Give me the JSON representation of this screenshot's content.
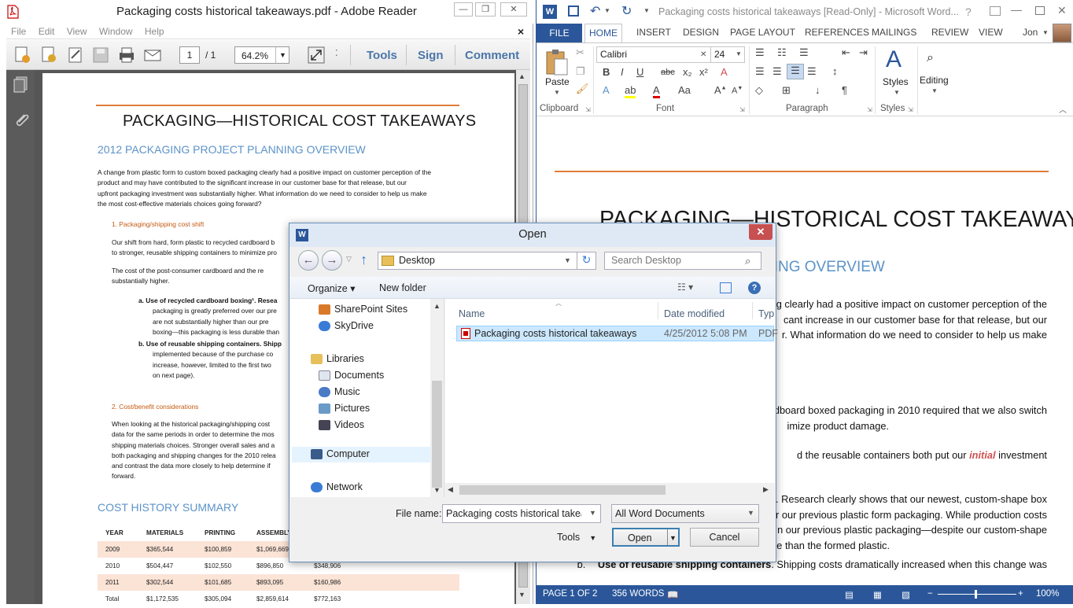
{
  "reader": {
    "title": "Packaging costs historical takeaways.pdf - Adobe Reader",
    "menu": [
      "File",
      "Edit",
      "View",
      "Window",
      "Help"
    ],
    "close_x": "×",
    "page_current": "1",
    "page_total": "/ 1",
    "zoom": "64.2%",
    "tools_label": "Tools",
    "sign_label": "Sign",
    "comment_label": "Comment",
    "doc": {
      "title": "PACKAGING—HISTORICAL COST TAKEAWAYS",
      "section1": "2012 PACKAGING PROJECT PLANNING OVERVIEW",
      "intro_lines": [
        "A change from plastic form to custom boxed packaging clearly had a positive impact on customer perception of the",
        "product and may have contributed to the significant increase in our customer base for that release, but our",
        "upfront packaging investment was substantially higher. What information do we need to consider to help us make",
        "the most cost-effective materials choices going forward?"
      ],
      "item1": "1.    Packaging/shipping cost shift",
      "item1_lines": [
        "Our shift from hard, form plastic to recycled cardboard b",
        "to stronger, reusable shipping containers to minimize pro"
      ],
      "item1_b_lines": [
        "The cost of the post-consumer cardboard and the re",
        "substantially higher."
      ],
      "sub_a_lines": [
        "a.    Use of recycled cardboard boxing¹. Resea",
        "packaging is greatly preferred over our pre",
        "are not substantially higher than our pre",
        "boxing—this packaging is less durable than"
      ],
      "sub_b_lines": [
        "b.    Use of reusable shipping containers. Shipp",
        "implemented because of the purchase co",
        "increase, however, limited to the first two",
        "on next page)."
      ],
      "item2": "2.    Cost/benefit considerations",
      "item2_lines": [
        "When looking at the historical packaging/shipping cost",
        "data for the same periods in order to determine the mos",
        "shipping materials choices. Stronger overall sales and a",
        "both packaging and shipping changes for the 2010 relea",
        "and contrast the data more closely to help determine if",
        "forward."
      ],
      "section2": "COST HISTORY SUMMARY",
      "table_headers": [
        "YEAR",
        "MATERIALS",
        "PRINTING",
        "ASSEMBLY",
        ""
      ],
      "table_rows": [
        [
          "2009",
          "$365,544",
          "$100,859",
          "$1,069,669",
          ""
        ],
        [
          "2010",
          "$504,447",
          "$102,550",
          "$896,850",
          "$348,906"
        ],
        [
          "2011",
          "$302,544",
          "$101,685",
          "$893,095",
          "$160,986"
        ],
        [
          "Total",
          "$1,172,535",
          "$305,094",
          "$2,859,614",
          "$772,163"
        ]
      ]
    }
  },
  "word": {
    "title": "Packaging costs historical takeaways [Read-Only] - Microsoft Word...",
    "help": "?",
    "user": "Jon",
    "tabs": [
      "FILE",
      "HOME",
      "INSERT",
      "DESIGN",
      "PAGE LAYOUT",
      "REFERENCES",
      "MAILINGS",
      "REVIEW",
      "VIEW"
    ],
    "font_name": "Calibri",
    "font_size": "24",
    "paste_label": "Paste",
    "styles_label": "Styles",
    "editing_label": "Editing",
    "groups": [
      "Clipboard",
      "Font",
      "Paragraph",
      "Styles"
    ],
    "doc": {
      "title": "PACKAGING—HISTORICAL COST TAKEAWAYS",
      "section1_tail": "NING OVERVIEW",
      "lines1": [
        "ng clearly had a positive impact on customer perception of the",
        "cant increase in our customer base for that release, but our",
        "r. What information do we need to consider to help us make",
        "ard?"
      ],
      "lines2": [
        "rdboard boxed packaging in 2010 required that we also switch",
        "imize product damage."
      ],
      "line3_pre": "d the reusable containers both put our",
      "line3_em": "initial",
      "line3_post": "investment",
      "lines4": [
        "g¹. Research clearly shows that our newest, custom-shape box",
        "r our previous plastic form packaging. While production costs",
        "n our previous plastic packaging—despite our custom-shape",
        "ble than the formed plastic."
      ],
      "line5_b": "b.",
      "line5_bold": "Use of reusable shipping containers",
      "line5_rest": ". Shipping costs dramatically increased when this change was"
    },
    "status": {
      "page": "PAGE 1 OF 2",
      "words": "356 WORDS",
      "zoom": "100%"
    }
  },
  "dialog": {
    "title": "Open",
    "close": "✕",
    "address": "Desktop",
    "search_placeholder": "Search Desktop",
    "organize": "Organize ▾",
    "new_folder": "New folder",
    "nav": {
      "sharepoint": "SharePoint Sites",
      "skydrive": "SkyDrive",
      "libraries": "Libraries",
      "documents": "Documents",
      "music": "Music",
      "pictures": "Pictures",
      "videos": "Videos",
      "computer": "Computer",
      "network": "Network"
    },
    "columns": [
      "Name",
      "Date modified",
      "Typ"
    ],
    "file": {
      "name": "Packaging costs historical takeaways",
      "date": "4/25/2012 5:08 PM",
      "type": "PDF"
    },
    "filename_label": "File name:",
    "filename_value": "Packaging costs historical takeaways",
    "filetype": "All Word Documents",
    "tools": "Tools",
    "open": "Open",
    "cancel": "Cancel"
  },
  "colors": {
    "word_blue": "#2b579a",
    "accent_orange": "#e07b39",
    "heading_blue": "#5c93c8",
    "table_shade": "#fbe3d6"
  }
}
